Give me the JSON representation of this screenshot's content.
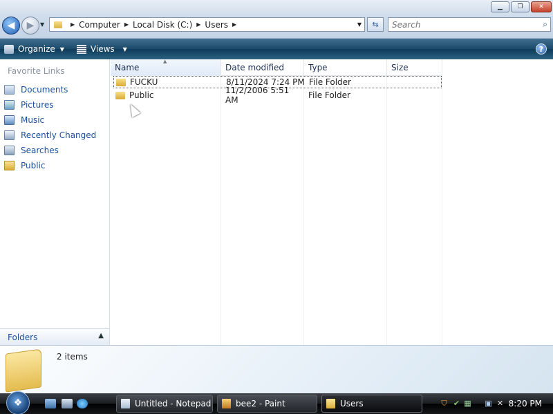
{
  "window": {
    "controls": [
      "minimize",
      "maximize",
      "close"
    ]
  },
  "address": {
    "crumbs": [
      "Computer",
      "Local Disk (C:)",
      "Users"
    ]
  },
  "search": {
    "placeholder": "Search"
  },
  "toolbar": {
    "organize_label": "Organize",
    "views_label": "Views",
    "help_label": "?"
  },
  "navpane": {
    "heading": "Favorite Links",
    "links": [
      {
        "label": "Documents",
        "icon": "documents-icon"
      },
      {
        "label": "Pictures",
        "icon": "pictures-icon"
      },
      {
        "label": "Music",
        "icon": "music-icon"
      },
      {
        "label": "Recently Changed",
        "icon": "recently-changed-icon"
      },
      {
        "label": "Searches",
        "icon": "searches-icon"
      },
      {
        "label": "Public",
        "icon": "folder-icon"
      }
    ],
    "folders_label": "Folders"
  },
  "list": {
    "columns": [
      "Name",
      "Date modified",
      "Type",
      "Size"
    ],
    "rows": [
      {
        "name": "FUCKU",
        "date": "8/11/2024 7:24 PM",
        "type": "File Folder",
        "size": "",
        "selected": true
      },
      {
        "name": "Public",
        "date": "11/2/2006 5:51 AM",
        "type": "File Folder",
        "size": "",
        "selected": false
      }
    ]
  },
  "details": {
    "count": "2 items"
  },
  "taskbar": {
    "tasks": [
      {
        "label": "Untitled - Notepad"
      },
      {
        "label": "bee2 - Paint"
      },
      {
        "label": "Users"
      }
    ],
    "clock": "8:20 PM"
  }
}
